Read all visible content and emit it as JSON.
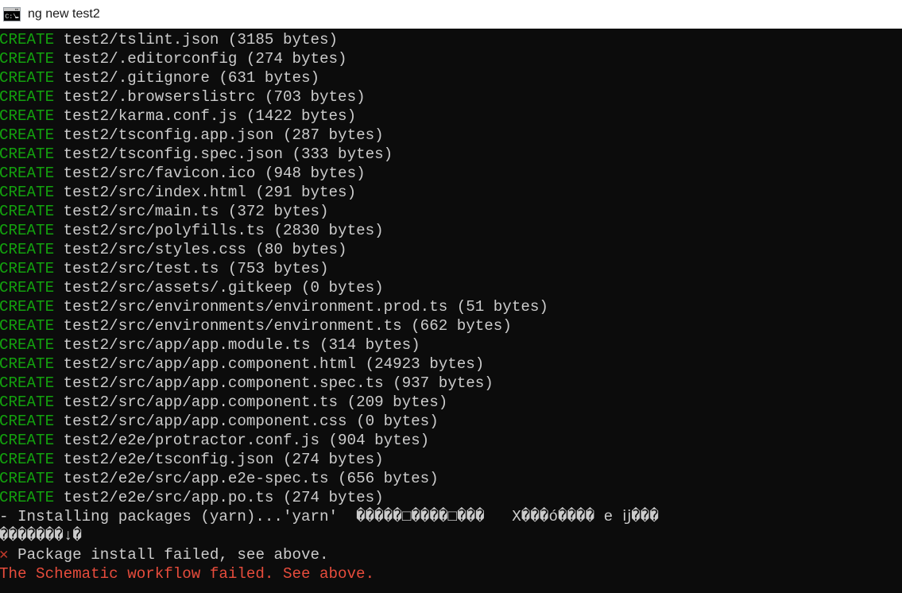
{
  "window": {
    "title": "ng new test2",
    "icon": "cmd-console-icon"
  },
  "colors": {
    "background": "#0c0c0c",
    "foreground": "#cccccc",
    "green": "#13a10e",
    "red": "#e74c3c",
    "titlebar_background": "#ffffff",
    "titlebar_text": "#1a1a1a"
  },
  "terminal": {
    "create_keyword": "CREATE",
    "created_files": [
      {
        "path": "test2/tslint.json",
        "size": "(3185 bytes)"
      },
      {
        "path": "test2/.editorconfig",
        "size": "(274 bytes)"
      },
      {
        "path": "test2/.gitignore",
        "size": "(631 bytes)"
      },
      {
        "path": "test2/.browserslistrc",
        "size": "(703 bytes)"
      },
      {
        "path": "test2/karma.conf.js",
        "size": "(1422 bytes)"
      },
      {
        "path": "test2/tsconfig.app.json",
        "size": "(287 bytes)"
      },
      {
        "path": "test2/tsconfig.spec.json",
        "size": "(333 bytes)"
      },
      {
        "path": "test2/src/favicon.ico",
        "size": "(948 bytes)"
      },
      {
        "path": "test2/src/index.html",
        "size": "(291 bytes)"
      },
      {
        "path": "test2/src/main.ts",
        "size": "(372 bytes)"
      },
      {
        "path": "test2/src/polyfills.ts",
        "size": "(2830 bytes)"
      },
      {
        "path": "test2/src/styles.css",
        "size": "(80 bytes)"
      },
      {
        "path": "test2/src/test.ts",
        "size": "(753 bytes)"
      },
      {
        "path": "test2/src/assets/.gitkeep",
        "size": "(0 bytes)"
      },
      {
        "path": "test2/src/environments/environment.prod.ts",
        "size": "(51 bytes)"
      },
      {
        "path": "test2/src/environments/environment.ts",
        "size": "(662 bytes)"
      },
      {
        "path": "test2/src/app/app.module.ts",
        "size": "(314 bytes)"
      },
      {
        "path": "test2/src/app/app.component.html",
        "size": "(24923 bytes)"
      },
      {
        "path": "test2/src/app/app.component.spec.ts",
        "size": "(937 bytes)"
      },
      {
        "path": "test2/src/app/app.component.ts",
        "size": "(209 bytes)"
      },
      {
        "path": "test2/src/app/app.component.css",
        "size": "(0 bytes)"
      },
      {
        "path": "test2/e2e/protractor.conf.js",
        "size": "(904 bytes)"
      },
      {
        "path": "test2/e2e/tsconfig.json",
        "size": "(274 bytes)"
      },
      {
        "path": "test2/e2e/src/app.e2e-spec.ts",
        "size": "(656 bytes)"
      },
      {
        "path": "test2/e2e/src/app.po.ts",
        "size": "(274 bytes)"
      }
    ],
    "installing_line": {
      "spinner": "-",
      "message": "Installing packages (yarn)...'yarn'",
      "garbled": "  �����□����□���   X���ó���� e ĳ���"
    },
    "garbled_continuation": "�������↓�",
    "package_failed": {
      "mark": "✕",
      "message": "Package install failed, see above."
    },
    "schematic_failed": "The Schematic workflow failed. See above."
  }
}
